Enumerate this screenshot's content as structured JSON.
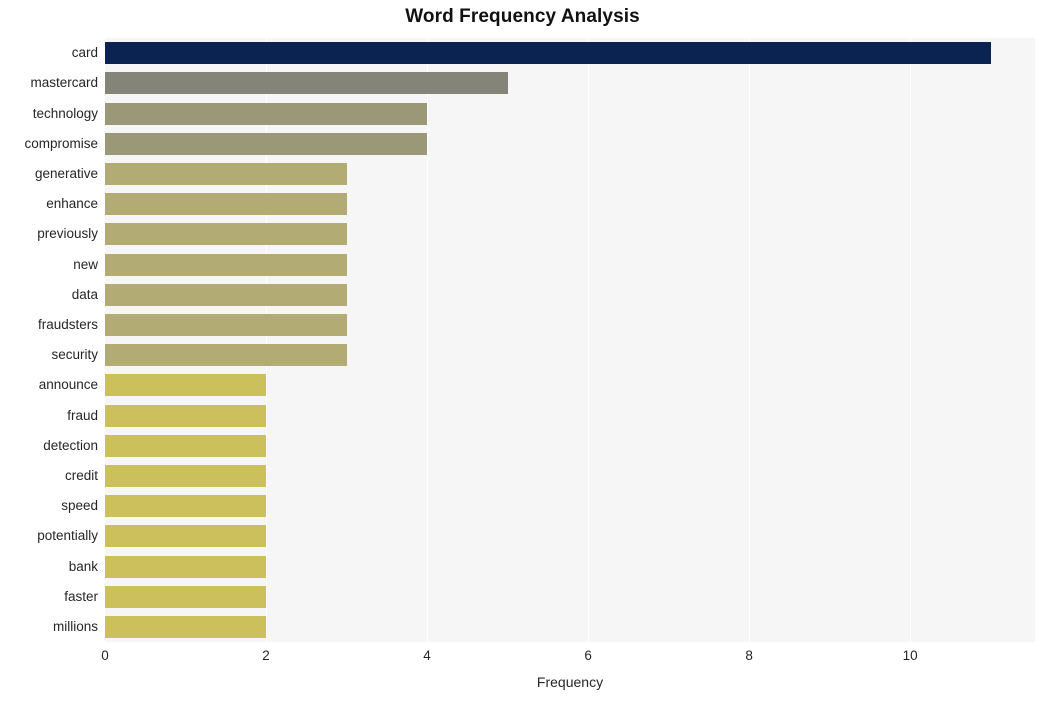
{
  "chart_data": {
    "type": "bar",
    "orientation": "horizontal",
    "title": "Word Frequency Analysis",
    "xlabel": "Frequency",
    "ylabel": "",
    "categories": [
      "card",
      "mastercard",
      "technology",
      "compromise",
      "generative",
      "enhance",
      "previously",
      "new",
      "data",
      "fraudsters",
      "security",
      "announce",
      "fraud",
      "detection",
      "credit",
      "speed",
      "potentially",
      "bank",
      "faster",
      "millions"
    ],
    "values": [
      11,
      5,
      4,
      4,
      3,
      3,
      3,
      3,
      3,
      3,
      3,
      2,
      2,
      2,
      2,
      2,
      2,
      2,
      2,
      2
    ],
    "bar_colors": [
      "#0a2351",
      "#848478",
      "#9b9878",
      "#9b9878",
      "#b3ab74",
      "#b3ab74",
      "#b3ab74",
      "#b3ab74",
      "#b3ab74",
      "#b3ab74",
      "#b3ab74",
      "#ccc05c",
      "#ccc05c",
      "#ccc05c",
      "#ccc05c",
      "#ccc05c",
      "#ccc05c",
      "#ccc05c",
      "#ccc05c",
      "#ccc05c"
    ],
    "xlim": [
      0,
      11.55
    ],
    "xticks": [
      0,
      2,
      4,
      6,
      8,
      10
    ],
    "xtick_labels": [
      "0",
      "2",
      "4",
      "6",
      "8",
      "10"
    ],
    "grid": true,
    "grid_axis": "x",
    "grid_color": "#ffffff",
    "legend": false,
    "plot_background": "#f6f6f7",
    "figure_background": "#ffffff",
    "title_color": "#111111",
    "tick_color": "#262626"
  }
}
